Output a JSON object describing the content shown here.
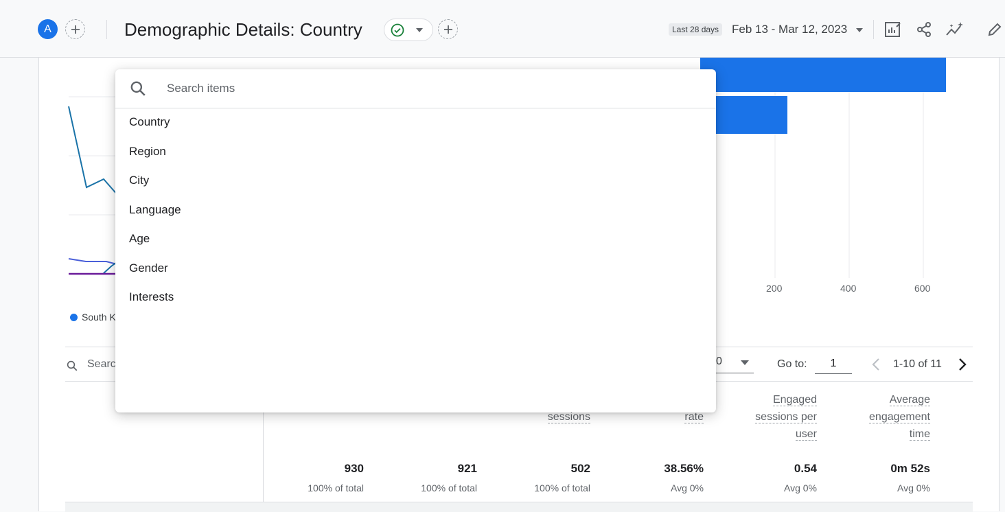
{
  "header": {
    "avatar_letter": "A",
    "title": "Demographic Details: Country",
    "date_chip": "Last 28 days",
    "date_range": "Feb 13 - Mar 12, 2023"
  },
  "chart": {
    "bar_axis_ticks": [
      "200",
      "400",
      "600"
    ],
    "legend_label": "South K"
  },
  "table_toolbar": {
    "search_placeholder": "Searc",
    "rows_per_page_value": "0",
    "goto_label": "Go to:",
    "goto_value": "1",
    "page_info": "1-10 of 11"
  },
  "table": {
    "headers": [
      {
        "lines": [
          "sessions"
        ]
      },
      {
        "lines": [
          "rate"
        ]
      },
      {
        "lines": [
          "Engaged",
          "sessions per",
          "user"
        ]
      },
      {
        "lines": [
          "Average",
          "engagement",
          "time"
        ]
      }
    ],
    "totals": [
      {
        "value": "930",
        "sub": "100% of total"
      },
      {
        "value": "921",
        "sub": "100% of total"
      },
      {
        "value": "502",
        "sub": "100% of total"
      },
      {
        "value": "38.56%",
        "sub": "Avg 0%"
      },
      {
        "value": "0.54",
        "sub": "Avg 0%"
      },
      {
        "value": "0m 52s",
        "sub": "Avg 0%"
      }
    ]
  },
  "dropdown": {
    "search_placeholder": "Search items",
    "items": [
      "Country",
      "Region",
      "City",
      "Language",
      "Age",
      "Gender",
      "Interests"
    ]
  },
  "colors": {
    "accent": "#1a73e8",
    "success": "#188038"
  }
}
